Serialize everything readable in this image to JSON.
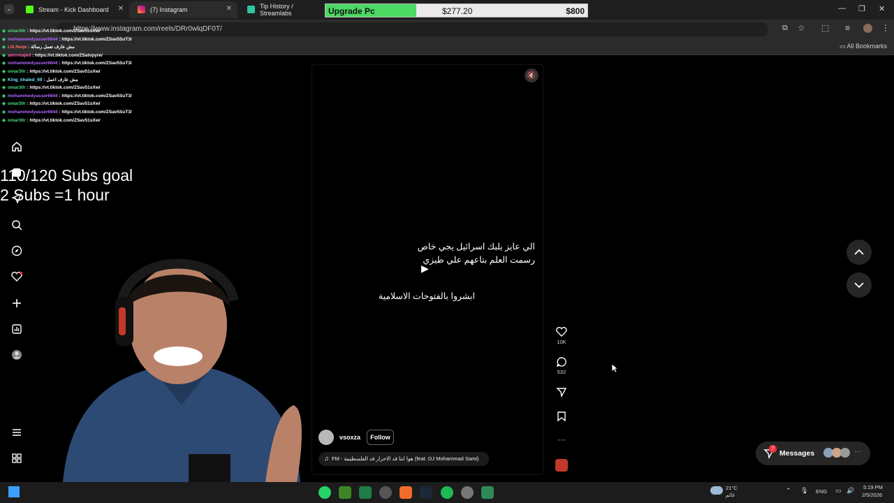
{
  "tabs": [
    {
      "title": "Stream - Kick Dashboard",
      "active": false,
      "favicon_color": "#53fc18"
    },
    {
      "title": "(7) Instagram",
      "active": true,
      "favicon_color": "#e1306c"
    },
    {
      "title": "Tip History / Streamlabs",
      "active": false,
      "favicon_color": "#31c3a2"
    }
  ],
  "upgrade_bar": {
    "label": "Upgrade Pc",
    "current": "$277.20",
    "goal": "$800",
    "progress": 0.3465
  },
  "address": {
    "url": "https://www.instagram.com/reels/DRr0wlqDF0T/"
  },
  "bookmarks": {
    "all_label": "All Bookmarks"
  },
  "chat": [
    {
      "user": "omar30r",
      "msg": "https://vt.tiktok.com/ZSav51sXw/",
      "color": "#4ade80"
    },
    {
      "user": "mohammedyasser6644",
      "msg": "https://vt.tiktok.com/ZSav5SuT3/",
      "color": "#b266ff"
    },
    {
      "user": "Lili.Nuqe",
      "msg": "مش عارف تعمل رسالة",
      "color": "#ff6b6b"
    },
    {
      "user": "amrrmajed",
      "msg": "https://vt.tiktok.com/ZSatvpyre/",
      "color": "#ff5fa2"
    },
    {
      "user": "mohammedyasser6644",
      "msg": "https://vt.tiktok.com/ZSav5SuT3/",
      "color": "#b266ff"
    },
    {
      "user": "omar30r",
      "msg": "https://vt.tiktok.com/ZSav51sXw/",
      "color": "#4ade80"
    },
    {
      "user": "King_khaled_69",
      "msg": "مش عارف اعمل",
      "color": "#6fe3ff"
    },
    {
      "user": "omar30r",
      "msg": "https://vt.tiktok.com/ZSav51sXw/",
      "color": "#4ade80"
    },
    {
      "user": "mohammedyasser6644",
      "msg": "https://vt.tiktok.com/ZSav5SuT3/",
      "color": "#b266ff"
    },
    {
      "user": "omar30r",
      "msg": "https://vt.tiktok.com/ZSav51sXw/",
      "color": "#4ade80"
    },
    {
      "user": "mohammedyasser6644",
      "msg": "https://vt.tiktok.com/ZSav5SuT3/",
      "color": "#b266ff"
    },
    {
      "user": "omar30r",
      "msg": "https://vt.tiktok.com/ZSav51sXw/",
      "color": "#4ade80"
    }
  ],
  "goal_overlay": {
    "line1": "110/120 Subs goal",
    "line2": "2 Subs =1 hour"
  },
  "nav_icons": [
    "home-icon",
    "reels-icon",
    "messages-icon",
    "search-icon",
    "explore-icon",
    "heart-icon",
    "create-icon",
    "insights-icon",
    "profile-icon",
    "menu-icon",
    "apps-icon"
  ],
  "reel": {
    "caption_line1": "الي عايز يلبك اسرائيل يجي خاص",
    "caption_line2": "رسمت العلم بتاعهم علي طيزي",
    "caption_line3": "ابشروا بالفتوحات الاسلامية",
    "username": "vsoxza",
    "follow_label": "Follow",
    "music": "FM - هوا انتا قد الاحرار قد الفلسطينية (feat. DJ Mohammad Sami)",
    "likes": "10K",
    "comments": "532"
  },
  "messages_widget": {
    "label": "Messages",
    "badge": "7"
  },
  "taskbar": {
    "weather_temp": "21°C",
    "weather_label": "غائم",
    "lang": "ENG",
    "time": "5:19 PM",
    "date": "2/5/2026"
  },
  "colors": {
    "accent_green": "#4cd964",
    "ig_red": "#ff3040"
  }
}
